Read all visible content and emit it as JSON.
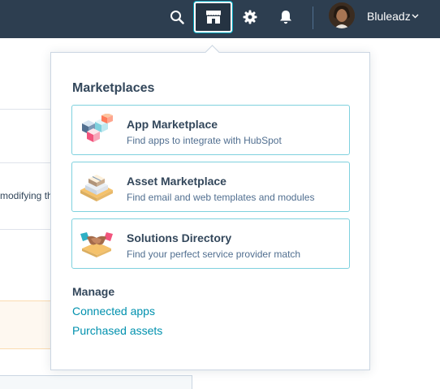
{
  "topbar": {
    "icons": [
      "search-icon",
      "marketplace-icon",
      "gear-icon",
      "bell-icon",
      "chevron-down-icon"
    ],
    "account_name": "Bluleadz"
  },
  "background_page": {
    "partial_text": "modifying th"
  },
  "marketplace_menu": {
    "title": "Marketplaces",
    "items": [
      {
        "title": "App Marketplace",
        "description": "Find apps to integrate with HubSpot",
        "icon": "app-blocks-icon"
      },
      {
        "title": "Asset Marketplace",
        "description": "Find email and web templates and modules",
        "icon": "asset-boxes-icon"
      },
      {
        "title": "Solutions Directory",
        "description": "Find your perfect service provider match",
        "icon": "handshake-icon"
      }
    ],
    "manage": {
      "title": "Manage",
      "links": [
        "Connected apps",
        "Purchased assets"
      ]
    }
  },
  "colors": {
    "nav_bg": "#2d3e50",
    "card_border": "#7fd1de",
    "link": "#0091ae",
    "text": "#33475b"
  }
}
